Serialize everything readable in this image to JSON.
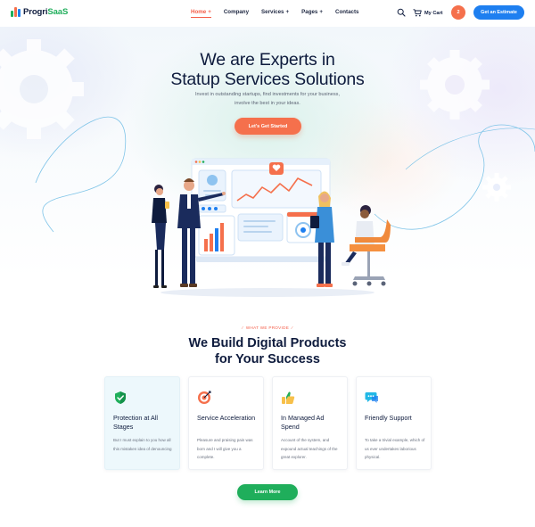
{
  "brand": {
    "name_part1": "Progri",
    "name_part2": "SaaS",
    "icon": "logo-bars-icon",
    "colors": {
      "green": "#1fae5b",
      "orange": "#f5704c",
      "blue": "#1e7ff0",
      "navy": "#0e1b3d"
    }
  },
  "nav": {
    "items": [
      {
        "label": "Home",
        "has_dropdown": true,
        "active": true
      },
      {
        "label": "Company",
        "has_dropdown": false,
        "active": false
      },
      {
        "label": "Services",
        "has_dropdown": true,
        "active": false
      },
      {
        "label": "Pages",
        "has_dropdown": true,
        "active": false
      },
      {
        "label": "Contacts",
        "has_dropdown": false,
        "active": false
      }
    ],
    "dropdown_glyph": "+"
  },
  "header": {
    "search_icon": "search-icon",
    "cart_label": "My Cart",
    "cart_icon": "cart-icon",
    "cart_count": "2",
    "estimate_label": "Get an Estimate"
  },
  "hero": {
    "title_line1": "We are Experts in",
    "title_line2": "Statup Services Solutions",
    "subtitle_line1": "Invest in outstanding startups, find investments for your business,",
    "subtitle_line2": "involve the best in your ideas.",
    "cta_label": "Let's Get Started"
  },
  "services": {
    "eyebrow": "WHAT WE PROVIDE",
    "title_line1": "We Build Digital Products",
    "title_line2": "for Your Success",
    "cards": [
      {
        "title": "Protection at All Stages",
        "text": "But I must explain to you how all this mistaken idea of denouncing",
        "icon": "shield-check-icon",
        "highlight": true
      },
      {
        "title": "Service Acceleration",
        "text": "Pleasure and praising pain was born and I will give you a complete.",
        "icon": "target-icon",
        "highlight": false
      },
      {
        "title": "In Managed Ad Spend",
        "text": "Account of the system, and expound actual teachings of the great explorer.",
        "icon": "thumbs-up-icon",
        "highlight": false
      },
      {
        "title": "Friendly Support",
        "text": "To take a trivial example, which of us ever undertakes laborious physical.",
        "icon": "chat-bubble-icon",
        "highlight": false
      }
    ],
    "button_label": "Learn More"
  }
}
